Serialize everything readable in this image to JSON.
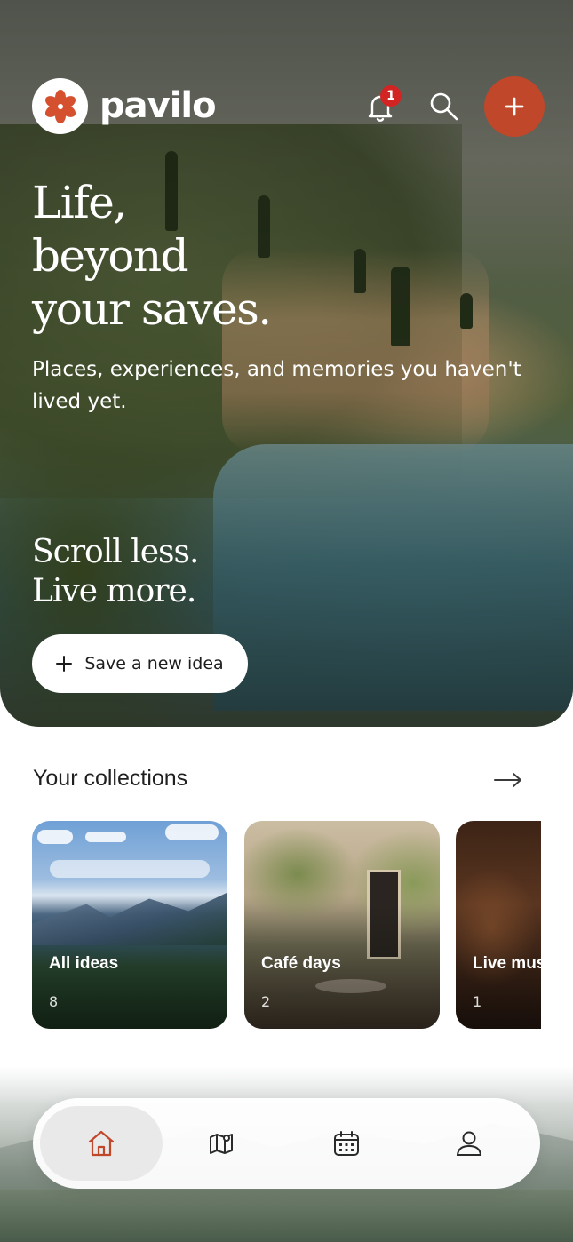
{
  "app": {
    "brand": "pavilo",
    "accent_color": "#c0472a",
    "notification_count": "1"
  },
  "header": {
    "logo_icon": "flower-logo-icon",
    "bell_icon": "bell-icon",
    "search_icon": "search-icon",
    "add_icon": "plus-icon"
  },
  "hero": {
    "headline": [
      "Life,",
      "beyond",
      "your saves."
    ],
    "subline": "Places, experiences, and memories you haven't lived yet.",
    "tagline": [
      "Scroll less.",
      "Live more."
    ],
    "cta_label": "Save a new idea"
  },
  "collections": {
    "title": "Your collections",
    "items": [
      {
        "name": "All ideas",
        "count": "8"
      },
      {
        "name": "Café days",
        "count": "2"
      },
      {
        "name": "Live music",
        "count": "1"
      }
    ]
  },
  "nav": {
    "items": [
      {
        "id": "home",
        "icon": "home-icon",
        "active": true
      },
      {
        "id": "map",
        "icon": "map-icon",
        "active": false
      },
      {
        "id": "calendar",
        "icon": "calendar-icon",
        "active": false
      },
      {
        "id": "profile",
        "icon": "profile-icon",
        "active": false
      }
    ]
  }
}
